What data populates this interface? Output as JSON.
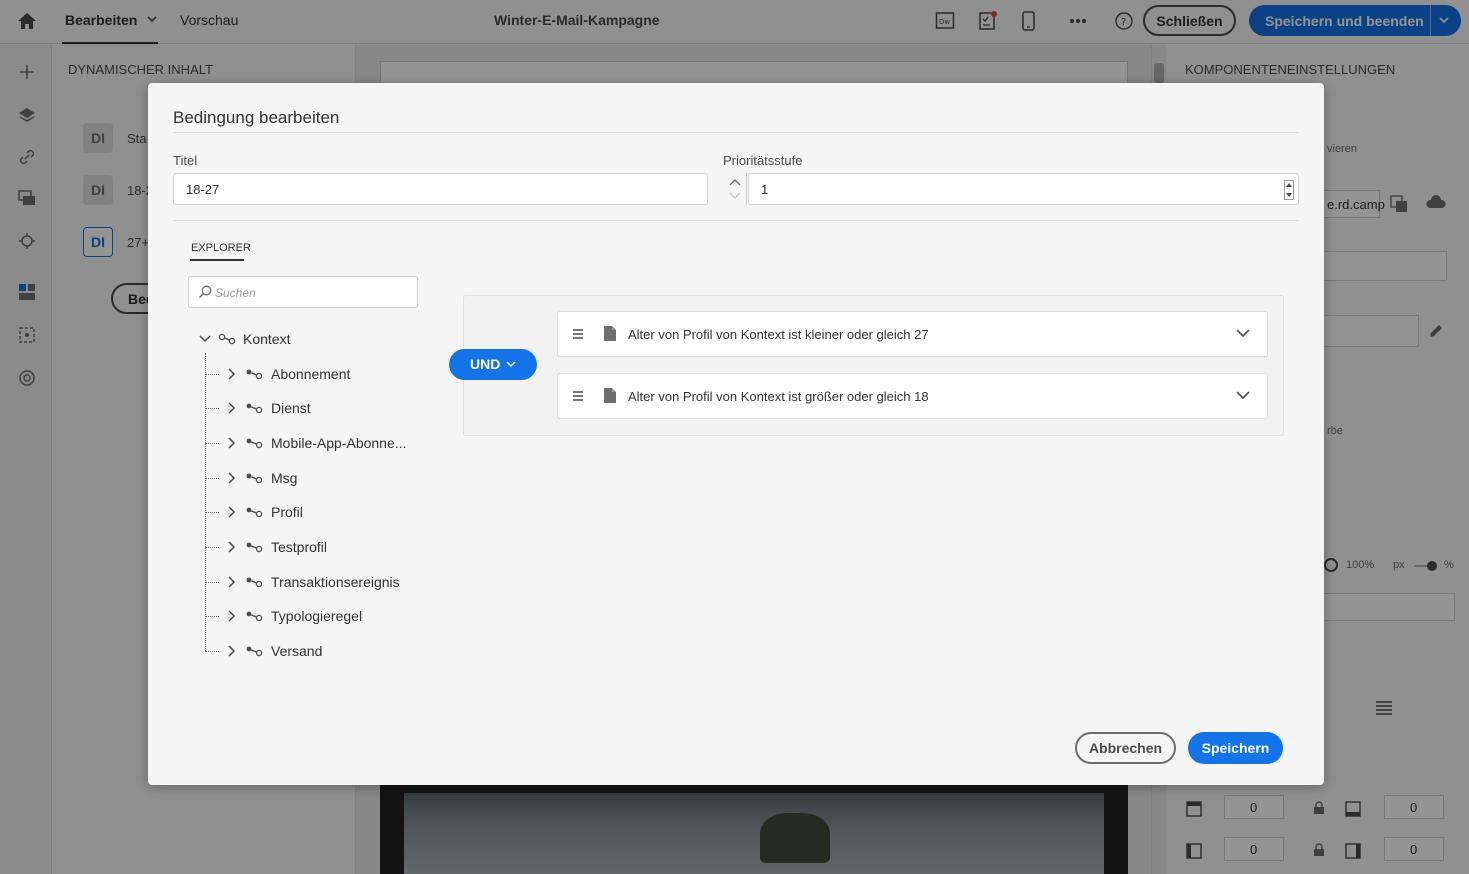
{
  "app": {
    "tabs": [
      {
        "label": "Bearbeiten"
      },
      {
        "label": "Vorschau"
      }
    ],
    "document_title": "Winter-E-Mail-Kampagne",
    "close_label": "Schließen",
    "save_and_finish_label": "Speichern und beenden",
    "toolbar_icons": [
      "dreamweaver-icon",
      "checklist-icon",
      "mobile-preview-icon",
      "more-icon",
      "help-icon"
    ]
  },
  "left_panel": {
    "header": "DYNAMISCHER INHALT",
    "items": [
      {
        "badge": "DI",
        "label": "Sta"
      },
      {
        "badge": "DI",
        "label": "18-2"
      },
      {
        "badge": "DI",
        "label": "27+"
      }
    ],
    "button_label": "Bed"
  },
  "right_panel": {
    "header": "KOMPONENTENEINSTELLUNGEN",
    "fragments": {
      "activate": "vieren",
      "link": "e.rd.camp",
      "color": "rbe",
      "percent": "100%",
      "unit_px": "px",
      "unit_pct": "%"
    },
    "padding_values": [
      "0",
      "0",
      "0",
      "0"
    ]
  },
  "modal": {
    "title": "Bedingung bearbeiten",
    "title_field": {
      "label": "Titel",
      "value": "18-27"
    },
    "priority_field": {
      "label": "Prioritätsstufe",
      "value": "1"
    },
    "explorer_tab": "EXPLORER",
    "search_placeholder": "Suchen",
    "tree": {
      "root": "Kontext",
      "children": [
        "Abonnement",
        "Dienst",
        "Mobile-App-Abonne...",
        "Msg",
        "Profil",
        "Testprofil",
        "Transaktionsereignis",
        "Typologieregel",
        "Versand"
      ]
    },
    "operator_label": "UND",
    "conditions": [
      "Alter von Profil von Kontext ist kleiner oder gleich 27",
      "Alter von Profil von Kontext ist größer oder gleich 18"
    ],
    "cancel_label": "Abbrechen",
    "save_label": "Speichern"
  },
  "colors": {
    "accent": "#1473e6",
    "overlay": "rgba(0,0,0,0.42)"
  }
}
